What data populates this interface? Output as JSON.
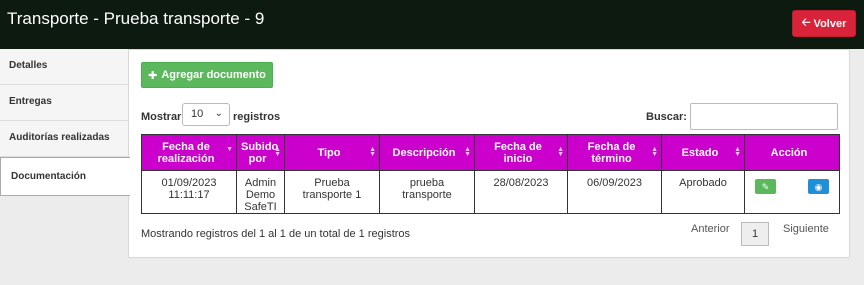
{
  "header": {
    "title": "Transporte - Prueba transporte - 9",
    "back_label": "Volver"
  },
  "sidebar": {
    "items": [
      {
        "label": "Detalles"
      },
      {
        "label": "Entregas"
      },
      {
        "label": "Auditorías realizadas"
      },
      {
        "label": "Documentación"
      }
    ]
  },
  "toolbar": {
    "add_label": "Agregar documento",
    "show_label": "Mostrar",
    "page_size": "10",
    "records_label": "registros",
    "search_label": "Buscar:"
  },
  "table": {
    "headers": [
      "Fecha de realización",
      "Subido por",
      "Tipo",
      "Descripción",
      "Fecha de inicio",
      "Fecha de término",
      "Estado",
      "Acción"
    ],
    "rows": [
      [
        "01/09/2023 11:11:17",
        "Admin Demo SafeTI",
        "Prueba transporte 1",
        "prueba transporte",
        "28/08/2023",
        "06/09/2023",
        "Aprobado"
      ]
    ]
  },
  "footer": {
    "info": "Mostrando registros del 1 al 1 de un total de 1 registros",
    "prev": "Anterior",
    "page": "1",
    "next": "Siguiente"
  },
  "colors": {
    "header_bg": "#0d1a10",
    "table_header": "#cc00cc",
    "success": "#5cb85c",
    "danger": "#d9233a",
    "info": "#1f8fd8"
  }
}
